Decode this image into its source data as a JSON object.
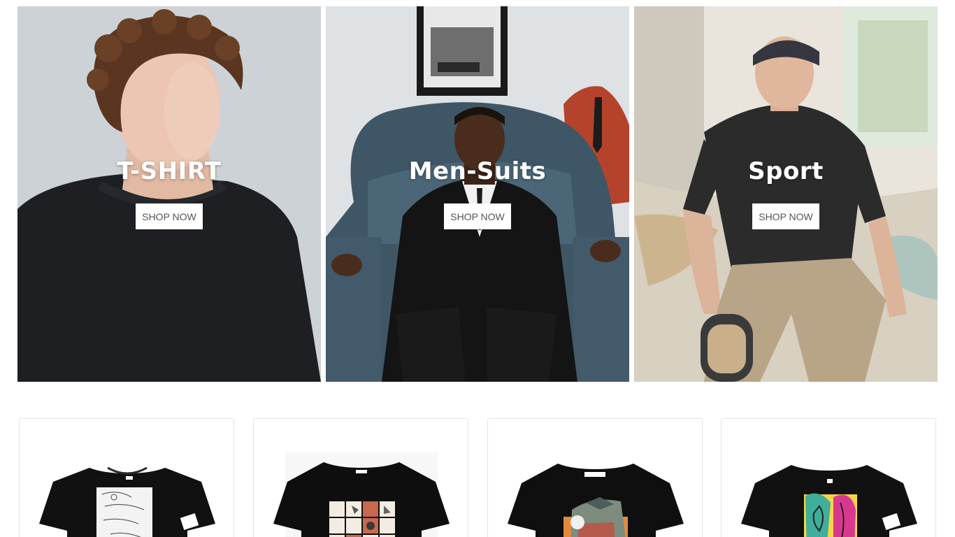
{
  "banners": [
    {
      "title": "T-SHIRT",
      "button": "SHOP NOW"
    },
    {
      "title": "Men-Suits",
      "button": "SHOP NOW"
    },
    {
      "title": "Sport",
      "button": "SHOP NOW"
    }
  ],
  "products": [
    {
      "image": "black-tshirt-sketch-print"
    },
    {
      "image": "black-tshirt-grid-print"
    },
    {
      "image": "black-tshirt-collage-print"
    },
    {
      "image": "black-tshirt-colorful-faces-print"
    }
  ],
  "colors": {
    "button_bg": "#ffffff",
    "button_text": "#555555",
    "title_text": "#ffffff",
    "card_border": "#e4e4e4"
  }
}
